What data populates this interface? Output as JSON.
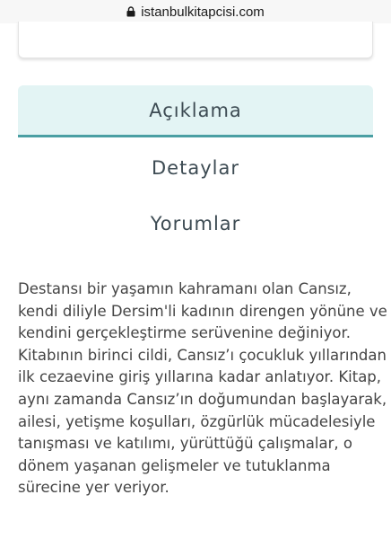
{
  "browser": {
    "url": "istanbulkitapcisi.com",
    "lock_icon": "lock-icon"
  },
  "tabs": [
    {
      "label": "Açıklama",
      "active": true
    },
    {
      "label": "Detaylar",
      "active": false
    },
    {
      "label": "Yorumlar",
      "active": false
    }
  ],
  "description": {
    "lines": [
      "Destansı bir yaşamın kahramanı olan Cansız,",
      "kendi diliyle Dersim'li kadının direngen yönüne ve",
      "kendini gerçekleştirme serüvenine değiniyor.",
      "Kitabının birinci cildi, Cansız’ı çocukluk yıllarından",
      "ilk cezaevine giriş yıllarına kadar anlatıyor. Kitap,",
      "aynı zamanda Cansız’ın doğumundan başlayarak,",
      "ailesi, yetişme koşulları, özgürlük mücadelesiyle",
      "tanışması ve katılımı, yürüttüğü çalışmalar, o",
      "dönem yaşanan gelişmeler ve tutuklanma",
      "sürecine yer veriyor."
    ]
  },
  "colors": {
    "active_tab_bg": "#e3f4f4",
    "active_tab_border": "#4a9fa3",
    "text": "#444444"
  }
}
